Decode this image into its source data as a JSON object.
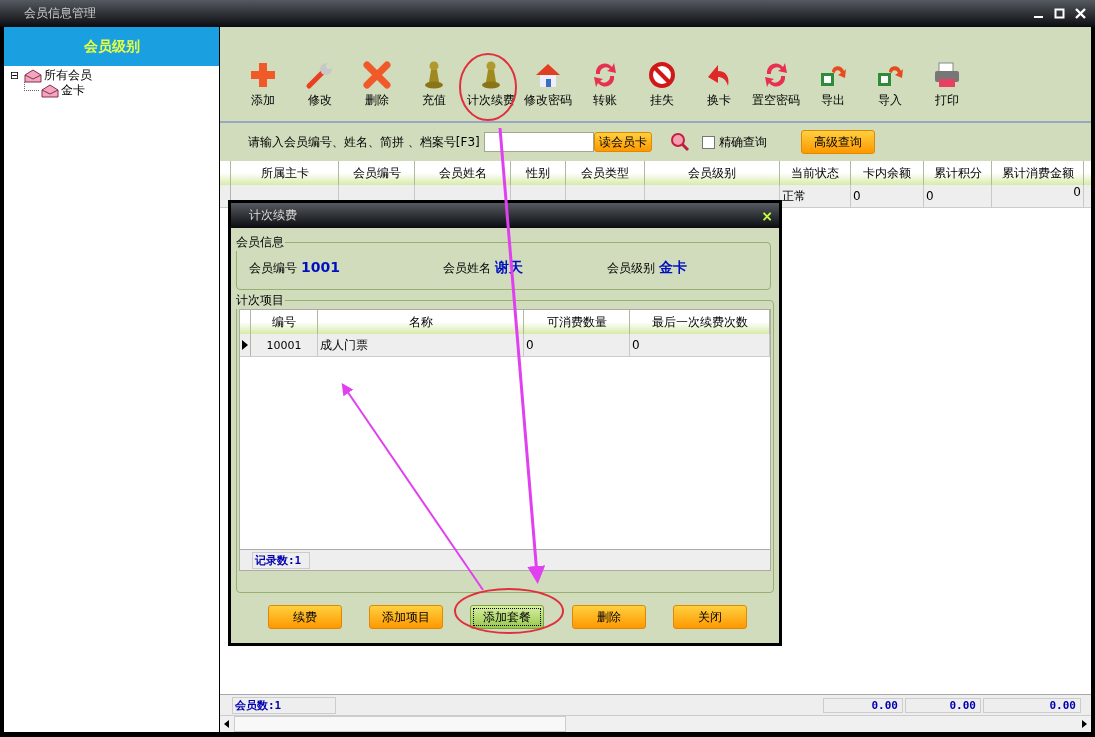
{
  "window": {
    "title": "会员信息管理"
  },
  "sidebar": {
    "title": "会员级别",
    "tree": [
      {
        "label": "所有会员",
        "expander": "⊟",
        "children": [
          {
            "label": "金卡"
          }
        ]
      }
    ]
  },
  "toolbar": [
    {
      "label": "添加"
    },
    {
      "label": "修改"
    },
    {
      "label": "删除"
    },
    {
      "label": "充值"
    },
    {
      "label": "计次续费"
    },
    {
      "label": "修改密码"
    },
    {
      "label": "转账"
    },
    {
      "label": "挂失"
    },
    {
      "label": "换卡"
    },
    {
      "label": "置空密码"
    },
    {
      "label": "导出"
    },
    {
      "label": "导入"
    },
    {
      "label": "打印"
    }
  ],
  "search": {
    "label": "请输入会员编号、姓名、简拼 、档案号[F3]",
    "read_card_button": "读会员卡",
    "exact_query": {
      "label": "精确查询",
      "checked": false
    },
    "advanced_button": "高级查询"
  },
  "table": {
    "columns": [
      "所属主卡",
      "会员编号",
      "会员姓名",
      "性别",
      "会员类型",
      "会员级别",
      "当前状态",
      "卡内余额",
      "累计积分",
      "累计消费金额"
    ],
    "rows": [
      {
        "status": "正常",
        "balance": "0",
        "points": "0",
        "total_spent": "0"
      }
    ]
  },
  "status_bar": {
    "count": "会员数:1",
    "totals": [
      "0.00",
      "0.00",
      "0.00"
    ]
  },
  "dialog": {
    "title": "计次续费",
    "close": "×",
    "member_info": {
      "legend": "会员信息",
      "fields": [
        {
          "label": "会员编号",
          "value": "1001"
        },
        {
          "label": "会员姓名",
          "value": "谢天"
        },
        {
          "label": "会员级别",
          "value": "金卡"
        }
      ]
    },
    "items": {
      "legend": "计次项目",
      "columns": [
        "编号",
        "名称",
        "可消费数量",
        "最后一次续费次数"
      ],
      "rows": [
        {
          "cells": [
            "10001",
            "成人门票",
            "0",
            "0"
          ],
          "selected": true
        }
      ],
      "record_count": "记录数:1"
    },
    "buttons": [
      {
        "label": "续费",
        "focused": false
      },
      {
        "label": "添加项目",
        "focused": false
      },
      {
        "label": "添加套餐",
        "focused": true
      },
      {
        "label": "删除",
        "focused": false
      },
      {
        "label": "关闭",
        "focused": false
      }
    ]
  }
}
